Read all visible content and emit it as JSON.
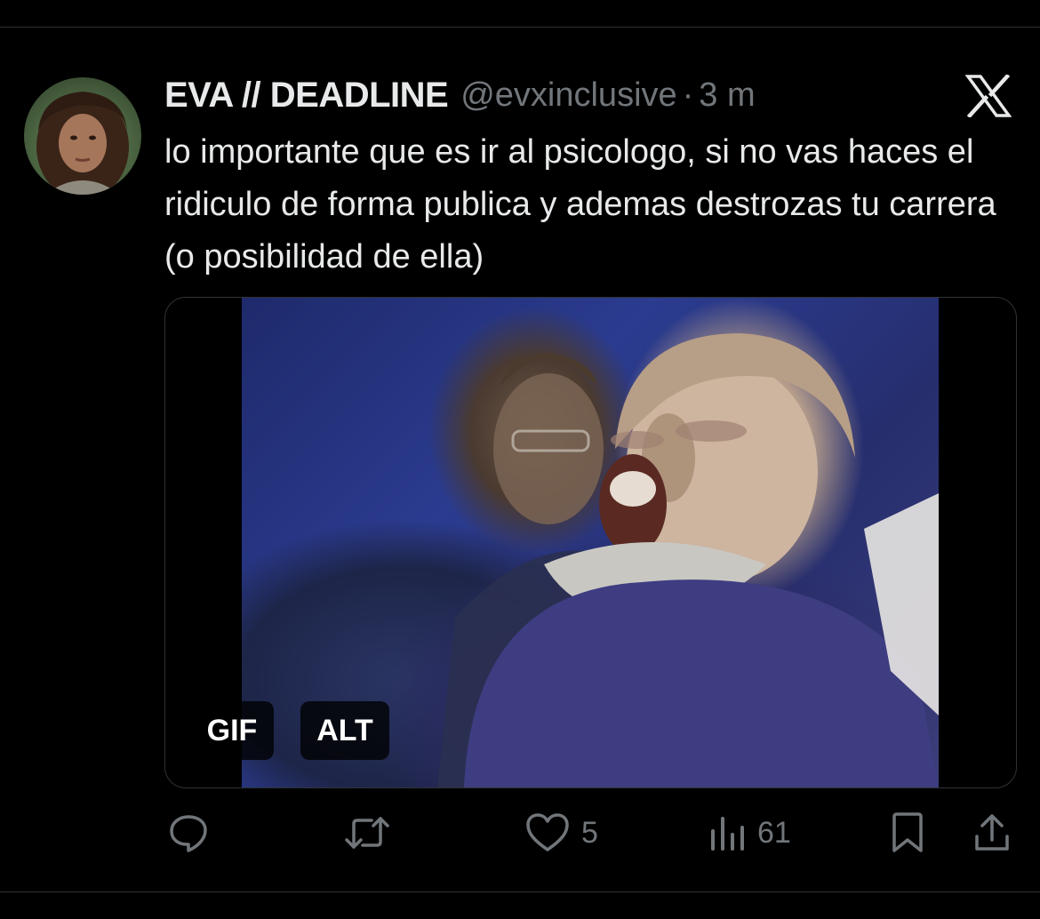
{
  "tweet": {
    "author_name": "EVA // DEADLINE",
    "handle": "@evxinclusive",
    "separator": "·",
    "time": "3 m",
    "text": "lo importante que es ir al psicologo, si no vas haces el ridiculo de forma publica y ademas destrozas tu carrera (o posibilidad de ella)"
  },
  "media": {
    "badges": {
      "gif": "GIF",
      "alt": "ALT"
    }
  },
  "actions": {
    "likes": "5",
    "views": "61"
  },
  "icons": {
    "logo": "x-logo-icon",
    "reply": "reply-bubble-icon",
    "retweet": "retweet-icon",
    "like": "heart-icon",
    "views": "views-bar-chart-icon",
    "bookmark": "bookmark-icon",
    "share": "share-upload-icon"
  },
  "colors": {
    "background": "#000000",
    "text_primary": "#e7e9ea",
    "text_secondary": "#71767b",
    "divider": "#2f3336"
  }
}
